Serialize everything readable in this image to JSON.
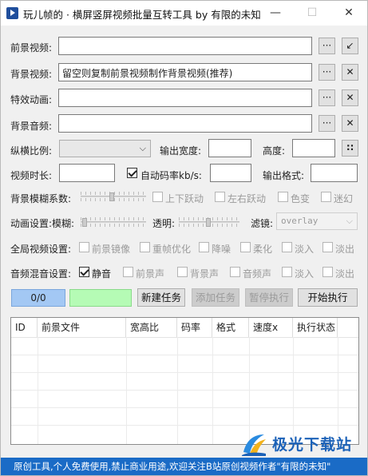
{
  "window": {
    "title": "玩儿帧的 · 横屏竖屏视频批量互转工具  by 有限的未知",
    "min_glyph": "—",
    "max_glyph": "☐",
    "close_glyph": "✕"
  },
  "fields": {
    "fg_video_label": "前景视频:",
    "bg_video_label": "背景视频:",
    "bg_video_value": "留空则复制前景视频制作背景视频(推荐)",
    "effect_label": "特效动画:",
    "bg_audio_label": "背景音频:",
    "ratio_label": "纵横比例:",
    "out_width_label": "输出宽度:",
    "height_label": "高度:",
    "duration_label": "视频时长:",
    "auto_bitrate_label": "自动码率kb/s:",
    "out_format_label": "输出格式:",
    "browse_glyph": "···",
    "arrow_glyph": "↙",
    "clear_glyph": "✕",
    "swap_glyph": "∷"
  },
  "blur": {
    "label": "背景模糊系数:",
    "options": [
      "上下跃动",
      "左右跃动",
      "色变",
      "迷幻"
    ]
  },
  "anim": {
    "label": "动画设置:模糊:",
    "alpha_label": "透明:",
    "filter_label": "滤镜:",
    "filter_value": "overlay"
  },
  "global": {
    "label": "全局视频设置:",
    "options": [
      "前景镜像",
      "重帧优化",
      "降噪",
      "柔化",
      "淡入",
      "淡出"
    ]
  },
  "mix": {
    "label": "音频混音设置:",
    "mute_label": "静音",
    "options": [
      "前景声",
      "背景声",
      "音频声",
      "淡入",
      "淡出"
    ]
  },
  "actions": {
    "progress": "0/0",
    "new_task": "新建任务",
    "add_task": "添加任务",
    "pause": "暂停执行",
    "start": "开始执行"
  },
  "table": {
    "columns": [
      "ID",
      "前景文件",
      "宽高比",
      "码率",
      "格式",
      "速度x",
      "执行状态"
    ]
  },
  "footer": "原创工具,个人免费使用,禁止商业用途,欢迎关注B站原创视频作者\"有限的未知\"",
  "watermark": "极光下载站",
  "colors": {
    "footer_bg": "#1a6bc6",
    "progress_bg": "#a3c8f4",
    "status_bg": "#b5fbb5"
  }
}
